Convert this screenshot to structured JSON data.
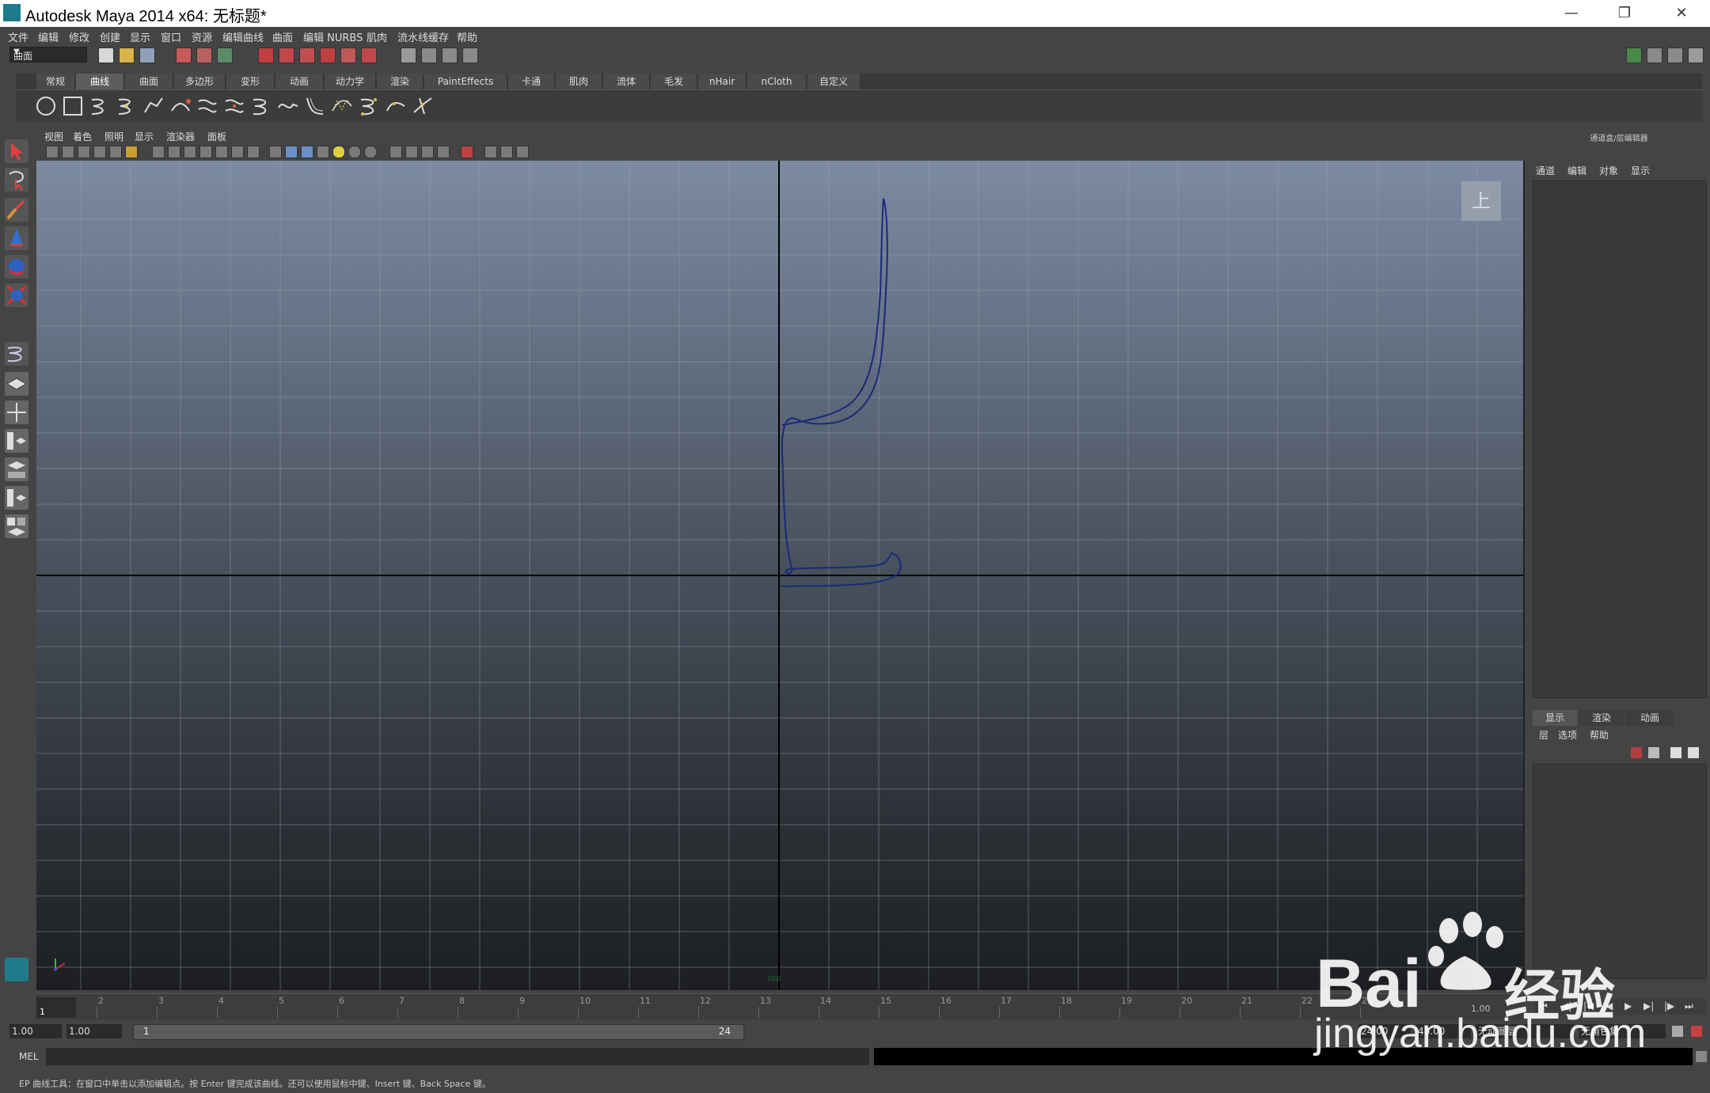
{
  "window": {
    "title": "Autodesk Maya 2014 x64: 无标题*"
  },
  "menu": [
    "文件",
    "编辑",
    "修改",
    "创建",
    "显示",
    "窗口",
    "资源",
    "编辑曲线",
    "曲面",
    "编辑 NURBS",
    "肌肉",
    "流水线缓存",
    "帮助"
  ],
  "status_line": {
    "mode": "曲面"
  },
  "shelf": {
    "tabs": [
      "常规",
      "曲线",
      "曲面",
      "多边形",
      "变形",
      "动画",
      "动力学",
      "渲染",
      "PaintEffects",
      "卡通",
      "肌肉",
      "流体",
      "毛发",
      "nHair",
      "nCloth",
      "自定义"
    ],
    "active_tab": "曲线"
  },
  "viewport": {
    "menu": [
      "视图",
      "着色",
      "照明",
      "显示",
      "渲染器",
      "面板"
    ],
    "camera_label": "上",
    "camera_name": "top"
  },
  "channel_box": {
    "title": "通道盒/层编辑器",
    "menu": [
      "通道",
      "编辑",
      "对象",
      "显示"
    ]
  },
  "layer_editor": {
    "tabs": [
      "显示",
      "渲染",
      "动画"
    ],
    "active_tab": "显示",
    "menu": [
      "层",
      "选项",
      "帮助"
    ]
  },
  "timeline": {
    "ticks": [
      "1",
      "2",
      "3",
      "4",
      "5",
      "6",
      "7",
      "8",
      "9",
      "10",
      "11",
      "12",
      "13",
      "14",
      "15",
      "16",
      "17",
      "18",
      "19",
      "20",
      "21",
      "22",
      "23"
    ],
    "current_frame": "1",
    "current_time_value": "1.00"
  },
  "range": {
    "start_time": "1.00",
    "playback_start": "1.00",
    "slider_start": "1",
    "slider_end": "24",
    "playback_end": "24.00",
    "end_time": "48.00",
    "anim_layer": "无动画层",
    "char_set": "无角色集"
  },
  "command": {
    "label": "MEL",
    "help": "EP 曲线工具：在窗口中单击以添加编辑点。按 Enter 键完成该曲线。还可以使用鼠标中键、Insert 键、Back Space 键。"
  },
  "watermark": {
    "brand": "Bai",
    "brand2": "经验",
    "url": "jingyan.baidu.com"
  }
}
